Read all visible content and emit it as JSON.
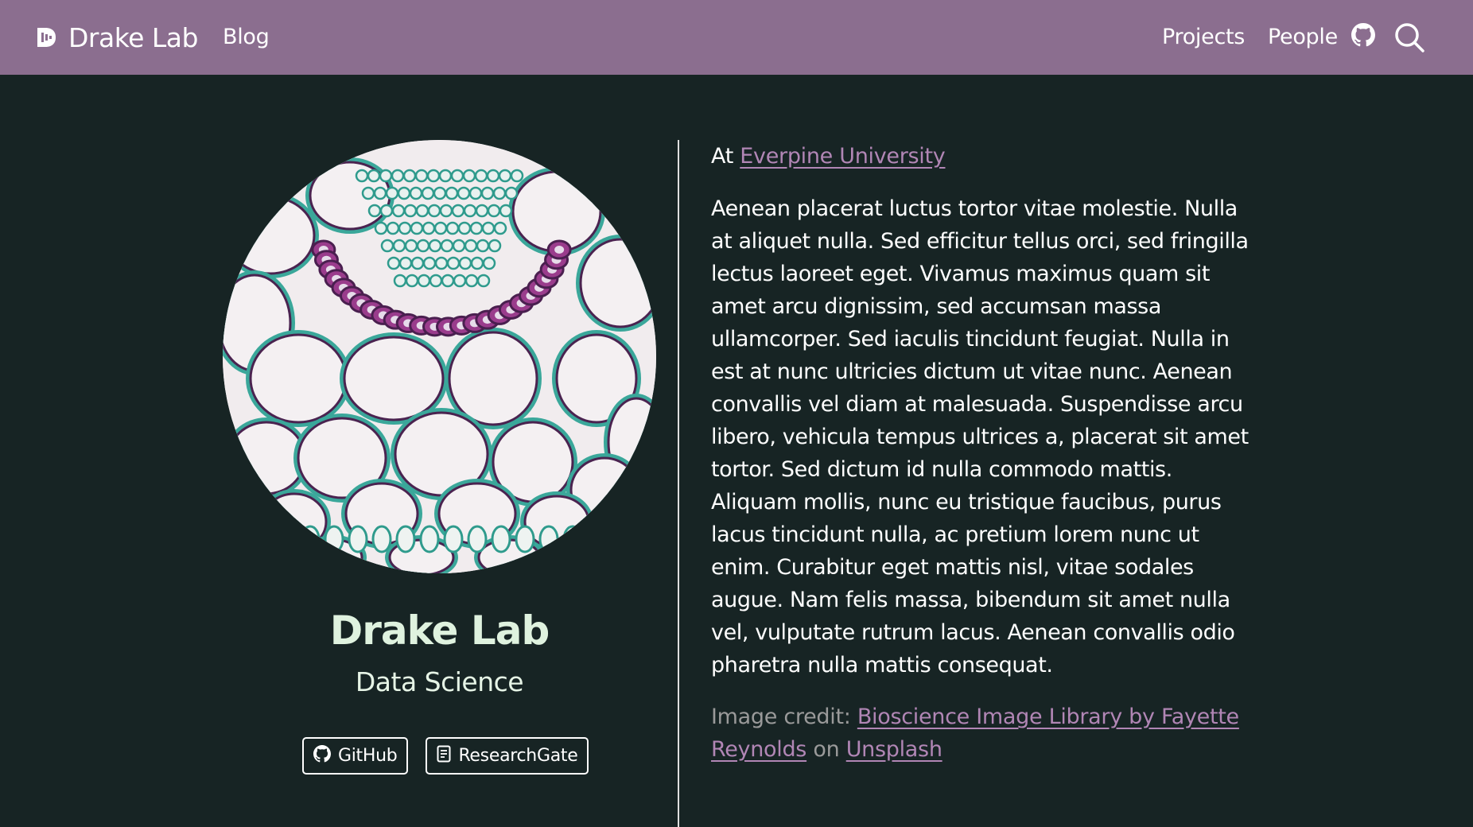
{
  "navbar": {
    "brand": "Drake Lab",
    "blog": "Blog",
    "projects": "Projects",
    "people": "People",
    "github_icon": "github-icon",
    "search_icon": "search-icon"
  },
  "profile": {
    "name": "Drake Lab",
    "subtitle": "Data Science",
    "buttons": [
      {
        "label": "GitHub",
        "icon": "github-icon"
      },
      {
        "label": "ResearchGate",
        "icon": "document-icon"
      }
    ]
  },
  "about": {
    "affiliation_prefix": "At",
    "affiliation_link": "Everpine University",
    "bio": "Aenean placerat luctus tortor vitae molestie. Nulla at aliquet nulla. Sed efficitur tellus orci, sed fringilla lectus laoreet eget. Vivamus maximus quam sit amet arcu dignissim, sed accumsan massa ullamcorper. Sed iaculis tincidunt feugiat. Nulla in est at nunc ultricies dictum ut vitae nunc. Aenean convallis vel diam at malesuada. Suspendisse arcu libero, vehicula tempus ultrices a, placerat sit amet tortor. Sed dictum id nulla commodo mattis. Aliquam mollis, nunc eu tristique faucibus, purus lacus tincidunt nulla, ac pretium lorem nunc ut enim. Curabitur eget mattis nisl, vitae sodales augue. Nam felis massa, bibendum sit amet nulla vel, vulputate rutrum lacus. Aenean convallis odio pharetra nulla mattis consequat.",
    "credit_prefix": "Image credit:",
    "credit_link": "Bioscience Image Library by Fayette Reynolds",
    "credit_on": "on",
    "credit_site": "Unsplash"
  },
  "colors": {
    "navbar_bg": "#8b6e8f",
    "page_bg": "#172424",
    "link": "#b186b5",
    "heading": "#dff2df",
    "credit_text": "#9a9a9a"
  }
}
